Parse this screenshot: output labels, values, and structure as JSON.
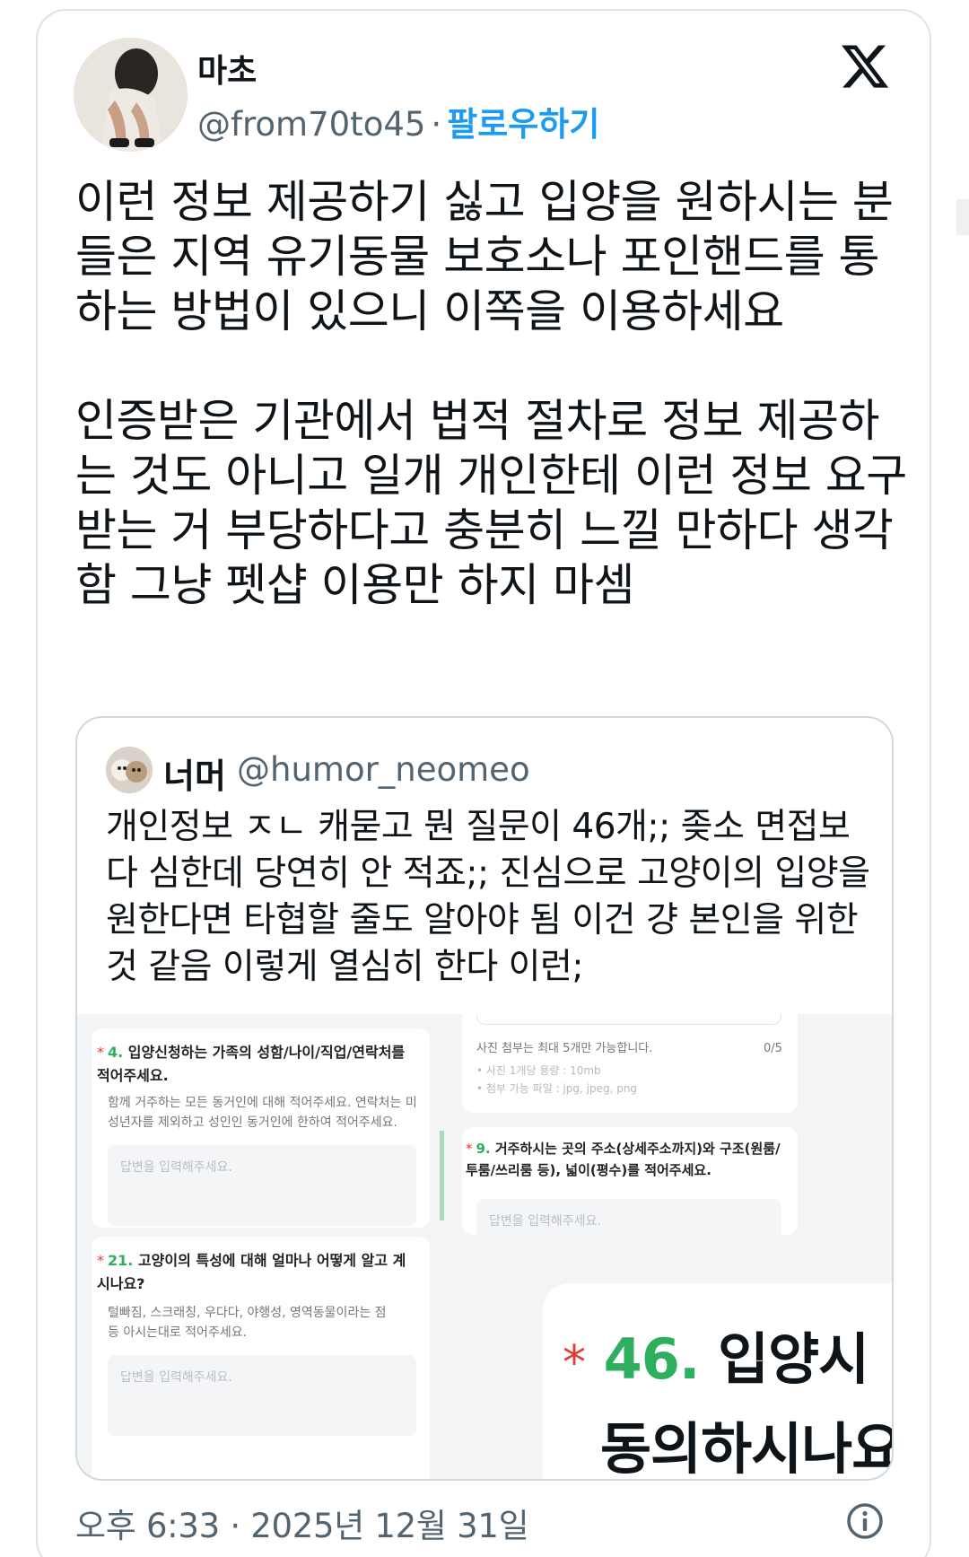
{
  "author": {
    "name": "마초",
    "handle": "@from70to45",
    "separator": "·",
    "follow_label": "팔로우하기"
  },
  "tweet": {
    "paragraph1": "이런 정보 제공하기 싫고 입양을 원하시는 분들은 지역 유기동물 보호소나 포인핸드를 통하는 방법이 있으니 이쪽을 이용하세요",
    "paragraph2": "인증받은 기관에서 법적 절차로 정보 제공하는 것도 아니고 일개 개인한테 이런 정보 요구받는 거 부당하다고 충분히 느낄 만하다 생각함 그냥 펫샵 이용만 하지 마셈"
  },
  "quote": {
    "name": "너머",
    "handle": "@humor_neomeo",
    "text": "개인정보 ㅈㄴ 캐묻고 뭔 질문이 46개;; 좆소 면접보다 심한데 당연히 안 적죠;; 진심으로 고양이의 입양을 원한다면 타협할 줄도 알아야 됨 이건 걍 본인을 위한 것 같음 이렇게 열심히 한다 이런;",
    "screenshot": {
      "q4": {
        "star": "*",
        "num": "4.",
        "text": "입양신청하는 가족의 성함/나이/직업/연락처를 적어주세요.",
        "desc": "함께 거주하는 모든 동거인에 대해 적어주세요. 연락처는 미성년자를 제외하고 성인인 동거인에 한하여 적어주세요.",
        "placeholder": "답변을 입력해주세요."
      },
      "photo": {
        "note": "사진 첨부는 최대 5개만 가능합니다.",
        "count": "0/5",
        "rule1": "• 사진 1개당 용량 : 10mb",
        "rule2": "• 첨부 가능 파일 : jpg, jpeg, png"
      },
      "q9": {
        "star": "*",
        "num": "9.",
        "text": "거주하시는 곳의 주소(상세주소까지)와 구조(원룸/투룸/쓰리룸 등), 넓이(평수)를 적어주세요.",
        "placeholder": "답변을 입력해주세요."
      },
      "q21": {
        "star": "*",
        "num": "21.",
        "text": "고양이의 특성에 대해 얼마나 어떻게 알고 계시나요?",
        "desc": "털빠짐, 스크래칭, 우다다, 야행성, 영역동물이라는 점 등 아시는대로 적어주세요.",
        "placeholder": "답변을 입력해주세요."
      },
      "q46": {
        "star": "*",
        "num": "46.",
        "line1": "입양시 ",
        "line2": "동의하시나요"
      }
    }
  },
  "footer": {
    "time": "오후 6:33",
    "separator": "·",
    "date": "2025년 12월 31일"
  },
  "icons": {
    "logo": "x-logo-icon",
    "info": "info-icon"
  }
}
